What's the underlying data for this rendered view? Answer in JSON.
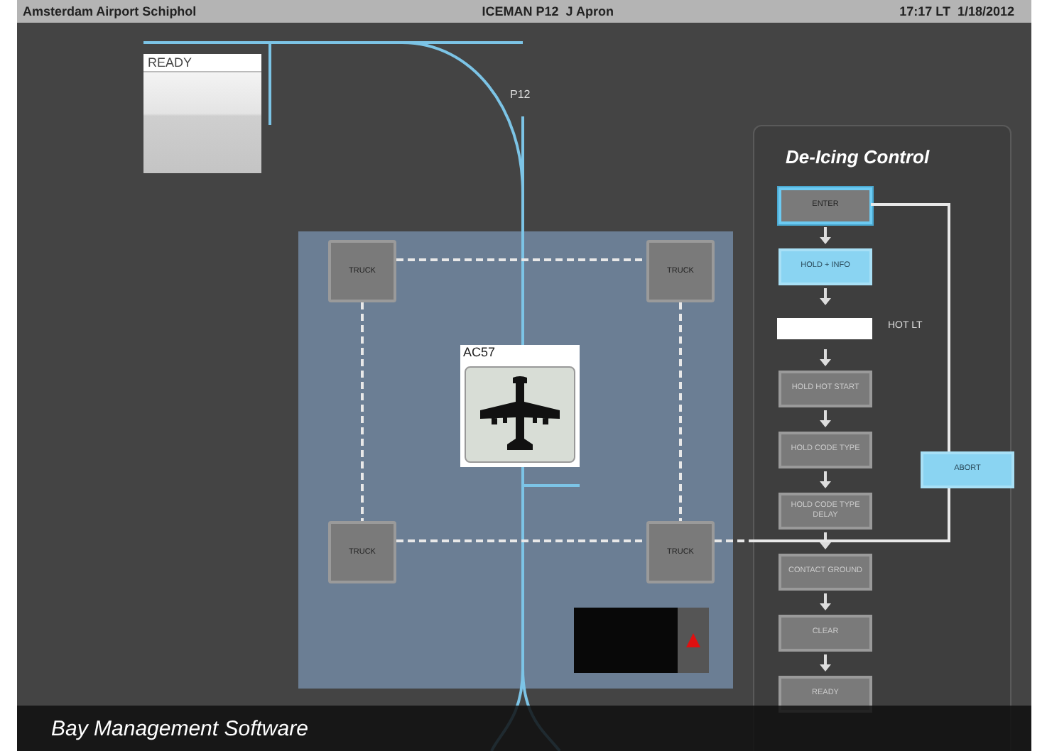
{
  "title_bar": {
    "left": "Amsterdam Airport Schiphol",
    "center": "ICEMAN P12  J Apron",
    "right": "17:17 LT  1/18/2012"
  },
  "ready_card": {
    "label": "READY"
  },
  "stand_label": "P12",
  "trucks": [
    {
      "label": "TRUCK"
    },
    {
      "label": "TRUCK"
    },
    {
      "label": "TRUCK"
    },
    {
      "label": "TRUCK"
    }
  ],
  "aircraft": {
    "label": "AC57"
  },
  "deicing_panel": {
    "title": "De-Icing Control",
    "steps": [
      {
        "kind": "button",
        "label": "ENTER",
        "selected": true,
        "active": false
      },
      {
        "kind": "button",
        "label": "HOLD + INFO",
        "selected": false,
        "active": true
      },
      {
        "kind": "field",
        "label": "HOT LT"
      },
      {
        "kind": "button",
        "label": "HOLD HOT START",
        "selected": false,
        "active": false
      },
      {
        "kind": "button",
        "label": "HOLD CODE TYPE",
        "selected": false,
        "active": false
      },
      {
        "kind": "button",
        "label": "HOLD CODE TYPE DELAY",
        "selected": false,
        "active": false
      },
      {
        "kind": "button",
        "label": "CONTACT GROUND",
        "selected": false,
        "active": false
      },
      {
        "kind": "button",
        "label": "CLEAR",
        "selected": false,
        "active": false
      },
      {
        "kind": "button",
        "label": "READY",
        "selected": false,
        "active": false
      }
    ],
    "abort": {
      "label": "ABORT",
      "active": true
    }
  },
  "caption": "Bay Management Software"
}
